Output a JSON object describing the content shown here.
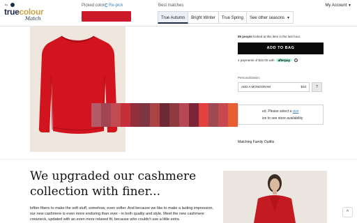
{
  "extension": {
    "logo": {
      "by": "by",
      "main_true": "true",
      "main_colour": "colour",
      "sub": "Match"
    },
    "picked_color_label": "Picked color",
    "repick_label": "Re-pick",
    "picked_color_hex": "#cc1a2a",
    "best_matches_label": "Best matches",
    "tabs": [
      {
        "label": "True Autumn",
        "active": true
      },
      {
        "label": "Bright Winter",
        "active": false
      },
      {
        "label": "True Spring",
        "active": false
      },
      {
        "label": "See other seasons",
        "active": false
      }
    ],
    "account_label": "My Account",
    "palette": [
      "#b35a67",
      "#a24552",
      "#c24a52",
      "#c62f3a",
      "#912f3d",
      "#7e3542",
      "#aa4444",
      "#6d2a36",
      "#8d3b3e",
      "#b64856",
      "#7a2638",
      "#e3413f",
      "#9e4a52",
      "#c64850",
      "#e85e33"
    ]
  },
  "product": {
    "viewers_bold": "89 people",
    "viewers_rest": "looked at this item in the last hour.",
    "add_to_bag": "ADD TO BAG",
    "payments_text": "4 payments of $32.00 with",
    "afterpay_label": "afterpay",
    "info_symbol": "i",
    "personalization_label": "Personalization:",
    "monogram_label": "ADD A MONOGRAM",
    "monogram_price": "$10",
    "help_symbol": "?",
    "size_note_prefix": "ed. Please select a",
    "size_note_link": "size",
    "size_note_line2": "ize to see store availability",
    "family_outfits": "Matching Family Outfits"
  },
  "story": {
    "title": "We upgraded our cashmere collection with finer...",
    "body": "loftier fibers to make the soft stuff, somehow, even softer. And because we like to make a lasting impression, our new cashmere is even more enduring than ever - in both quality and style. Meet the new cashmere crewneck, updated with an even more relaxed fit, because who couldn't use a little extra"
  },
  "scroll_top_symbol": "^"
}
